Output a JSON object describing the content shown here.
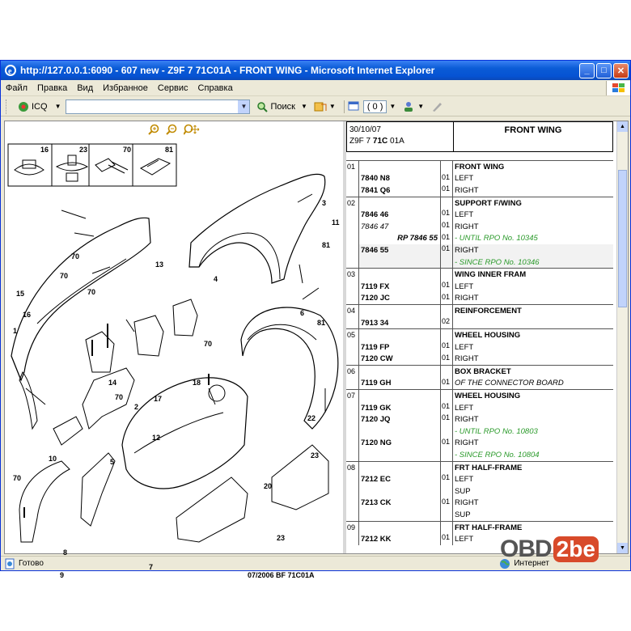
{
  "window": {
    "title": "http://127.0.0.1:6090 - 607 new - Z9F 7 71C01A - FRONT WING - Microsoft Internet Explorer"
  },
  "menu": [
    "Файл",
    "Правка",
    "Вид",
    "Избранное",
    "Сервис",
    "Справка"
  ],
  "toolbar": {
    "icq": "ICQ",
    "search": "Поиск",
    "count": "( 0 )"
  },
  "diagram": {
    "caption": "07/2006 BF 71C01A",
    "fasteners": [
      "16",
      "23",
      "70",
      "81"
    ],
    "callouts": [
      "1",
      "2",
      "3",
      "4",
      "5",
      "6",
      "7",
      "8",
      "9",
      "10",
      "11",
      "12",
      "13",
      "14",
      "15",
      "16",
      "17",
      "18",
      "20",
      "22",
      "23",
      "23",
      "70",
      "70",
      "70",
      "70",
      "70",
      "70",
      "81",
      "81"
    ]
  },
  "parts": {
    "date": "30/10/07",
    "code_prefix": "Z9F 7 ",
    "code_bold": "71C",
    "code_suffix": " 01A",
    "title": "FRONT WING",
    "groups": [
      {
        "n": "01",
        "rows": [
          {
            "ref": "",
            "q": "",
            "d": "FRONT WING",
            "s": "hd"
          },
          {
            "ref": "7840 N8",
            "q": "01",
            "d": "LEFT"
          },
          {
            "ref": "7841 Q6",
            "q": "01",
            "d": "RIGHT"
          }
        ]
      },
      {
        "n": "02",
        "rows": [
          {
            "ref": "",
            "q": "",
            "d": "SUPPORT F/WING",
            "s": "hd"
          },
          {
            "ref": "7846 46",
            "q": "01",
            "d": "LEFT"
          },
          {
            "ref": "7846 47",
            "q": "01",
            "d": "RIGHT",
            "rs": "it"
          },
          {
            "ref": "RP 7846 55",
            "q": "01",
            "d": "- UNTIL RPO No. 10345",
            "s": "gr",
            "rs": "rp"
          },
          {
            "ref": "7846 55",
            "q": "01",
            "d": "RIGHT",
            "sh": true
          },
          {
            "ref": "",
            "q": "",
            "d": "- SINCE RPO No. 10346",
            "s": "gr",
            "sh": true
          }
        ]
      },
      {
        "n": "03",
        "rows": [
          {
            "ref": "",
            "q": "",
            "d": "WING INNER FRAM",
            "s": "hd"
          },
          {
            "ref": "7119 FX",
            "q": "01",
            "d": "LEFT"
          },
          {
            "ref": "7120 JC",
            "q": "01",
            "d": "RIGHT"
          }
        ]
      },
      {
        "n": "04",
        "rows": [
          {
            "ref": "",
            "q": "",
            "d": "REINFORCEMENT",
            "s": "hd"
          },
          {
            "ref": "7913 34",
            "q": "02",
            "d": ""
          }
        ]
      },
      {
        "n": "05",
        "rows": [
          {
            "ref": "",
            "q": "",
            "d": "WHEEL HOUSING",
            "s": "hd"
          },
          {
            "ref": "7119 FP",
            "q": "01",
            "d": "LEFT"
          },
          {
            "ref": "7120 CW",
            "q": "01",
            "d": "RIGHT"
          }
        ]
      },
      {
        "n": "06",
        "rows": [
          {
            "ref": "",
            "q": "",
            "d": "BOX BRACKET",
            "s": "hd"
          },
          {
            "ref": "7119 GH",
            "q": "01",
            "d": "OF THE CONNECTOR BOARD",
            "s": "it"
          }
        ]
      },
      {
        "n": "07",
        "rows": [
          {
            "ref": "",
            "q": "",
            "d": "WHEEL HOUSING",
            "s": "hd"
          },
          {
            "ref": "7119 GK",
            "q": "01",
            "d": "LEFT"
          },
          {
            "ref": "7120 JQ",
            "q": "01",
            "d": "RIGHT"
          },
          {
            "ref": "",
            "q": "",
            "d": "- UNTIL RPO No. 10803",
            "s": "gr"
          },
          {
            "ref": "7120 NG",
            "q": "01",
            "d": "RIGHT"
          },
          {
            "ref": "",
            "q": "",
            "d": "- SINCE RPO No. 10804",
            "s": "gr"
          }
        ]
      },
      {
        "n": "08",
        "rows": [
          {
            "ref": "",
            "q": "",
            "d": "FRT HALF-FRAME",
            "s": "hd"
          },
          {
            "ref": "7212 EC",
            "q": "01",
            "d": "LEFT"
          },
          {
            "ref": "",
            "q": "",
            "d": "SUP"
          },
          {
            "ref": "7213 CK",
            "q": "01",
            "d": "RIGHT"
          },
          {
            "ref": "",
            "q": "",
            "d": "SUP"
          }
        ]
      },
      {
        "n": "09",
        "rows": [
          {
            "ref": "",
            "q": "",
            "d": "FRT HALF-FRAME",
            "s": "hd"
          },
          {
            "ref": "7212 KK",
            "q": "01",
            "d": "LEFT"
          }
        ]
      }
    ]
  },
  "status": {
    "left": "Готово",
    "zone": "Интернет"
  },
  "watermark": {
    "a": "OBD",
    "b": "2be"
  }
}
